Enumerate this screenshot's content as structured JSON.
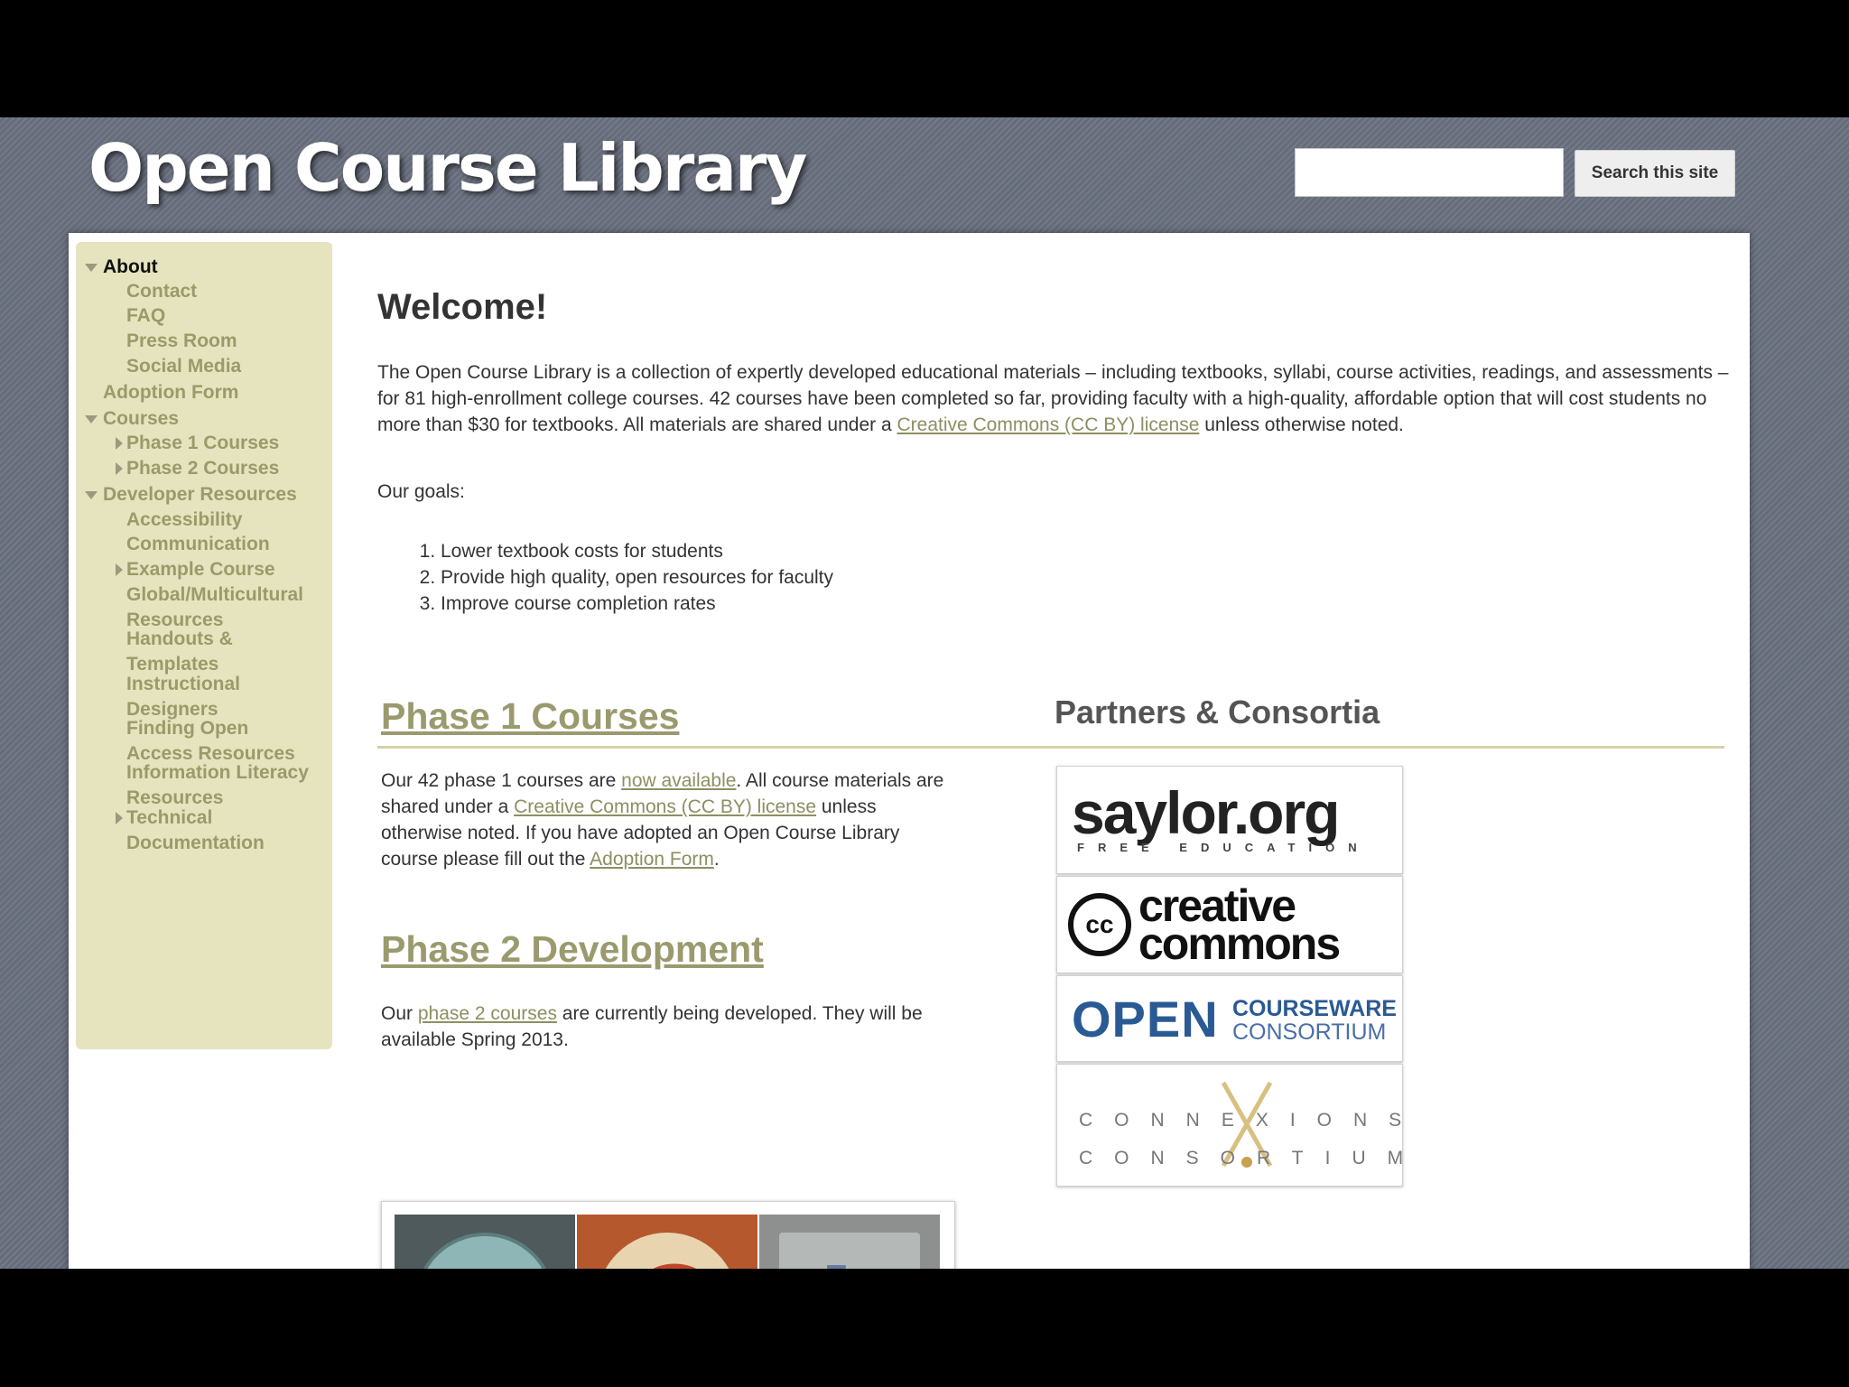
{
  "header": {
    "site_title": "Open Course Library",
    "search_placeholder": "",
    "search_button": "Search this site"
  },
  "sidebar": {
    "items": [
      {
        "label": "About"
      },
      {
        "label": "Contact"
      },
      {
        "label": "FAQ"
      },
      {
        "label": "Press Room"
      },
      {
        "label": "Social Media"
      },
      {
        "label": "Adoption Form"
      },
      {
        "label": "Courses"
      },
      {
        "label": "Phase 1 Courses"
      },
      {
        "label": "Phase 2 Courses"
      },
      {
        "label": "Developer Resources"
      },
      {
        "label": "Accessibility"
      },
      {
        "label": "Communication"
      },
      {
        "label": "Example Course"
      },
      {
        "label": "Global/Multicultural Resources"
      },
      {
        "label": "Handouts & Templates"
      },
      {
        "label": "Instructional Designers"
      },
      {
        "label": "Finding Open Access Resources"
      },
      {
        "label": "Information Literacy Resources"
      },
      {
        "label": "Technical Documentation"
      }
    ]
  },
  "main": {
    "welcome_title": "Welcome!",
    "intro": {
      "text_before_link": "The Open Course Library is a collection of expertly developed educational materials – including textbooks, syllabi, course activities, readings, and assessments – for 81 high-enrollment college courses. 42 courses have been completed so far, providing faculty with a high-quality, affordable option that will cost students no more than $30 for textbooks. All materials are shared under a ",
      "link": "Creative Commons (CC BY) license",
      "text_after_link": " unless otherwise noted."
    },
    "goals_label": "Our goals:",
    "goals": [
      "Lower textbook costs for students",
      "Provide high quality, open resources for faculty",
      "Improve course completion rates"
    ],
    "phase1": {
      "title": "Phase 1 Courses",
      "t1": "Our 42 phase 1 courses are ",
      "link1": "now available",
      "t2": ". All course materials are shared under a ",
      "link2": "Creative Commons (CC BY) license",
      "t3": " unless otherwise noted. If you have adopted an Open Course Library course please fill out the ",
      "link3": "Adoption Form",
      "t4": "."
    },
    "phase2": {
      "title": "Phase 2 Development",
      "t1": "Our ",
      "link1": "phase 2 courses",
      "t2": " are currently being developed. They will be available Spring 2013."
    },
    "ocl_letters": [
      "O",
      "C",
      "L"
    ]
  },
  "partners": {
    "title": "Partners & Consortia",
    "saylor": {
      "main": "saylor.org",
      "sub": "FREE EDUCATION"
    },
    "cc": {
      "symbol": "cc",
      "line1": "creative",
      "line2": "commons"
    },
    "ocw": {
      "open": "OPEN",
      "line1": "COURSEWARE",
      "line2": "CONSORTIUM"
    },
    "cnx": {
      "line1": "CONNEXIONS",
      "line2": "CONSORTIUM"
    }
  },
  "colors": {
    "link": "#8e8e62",
    "sidebar_bg": "#e6e4be",
    "page_bg": "#6b7281"
  }
}
